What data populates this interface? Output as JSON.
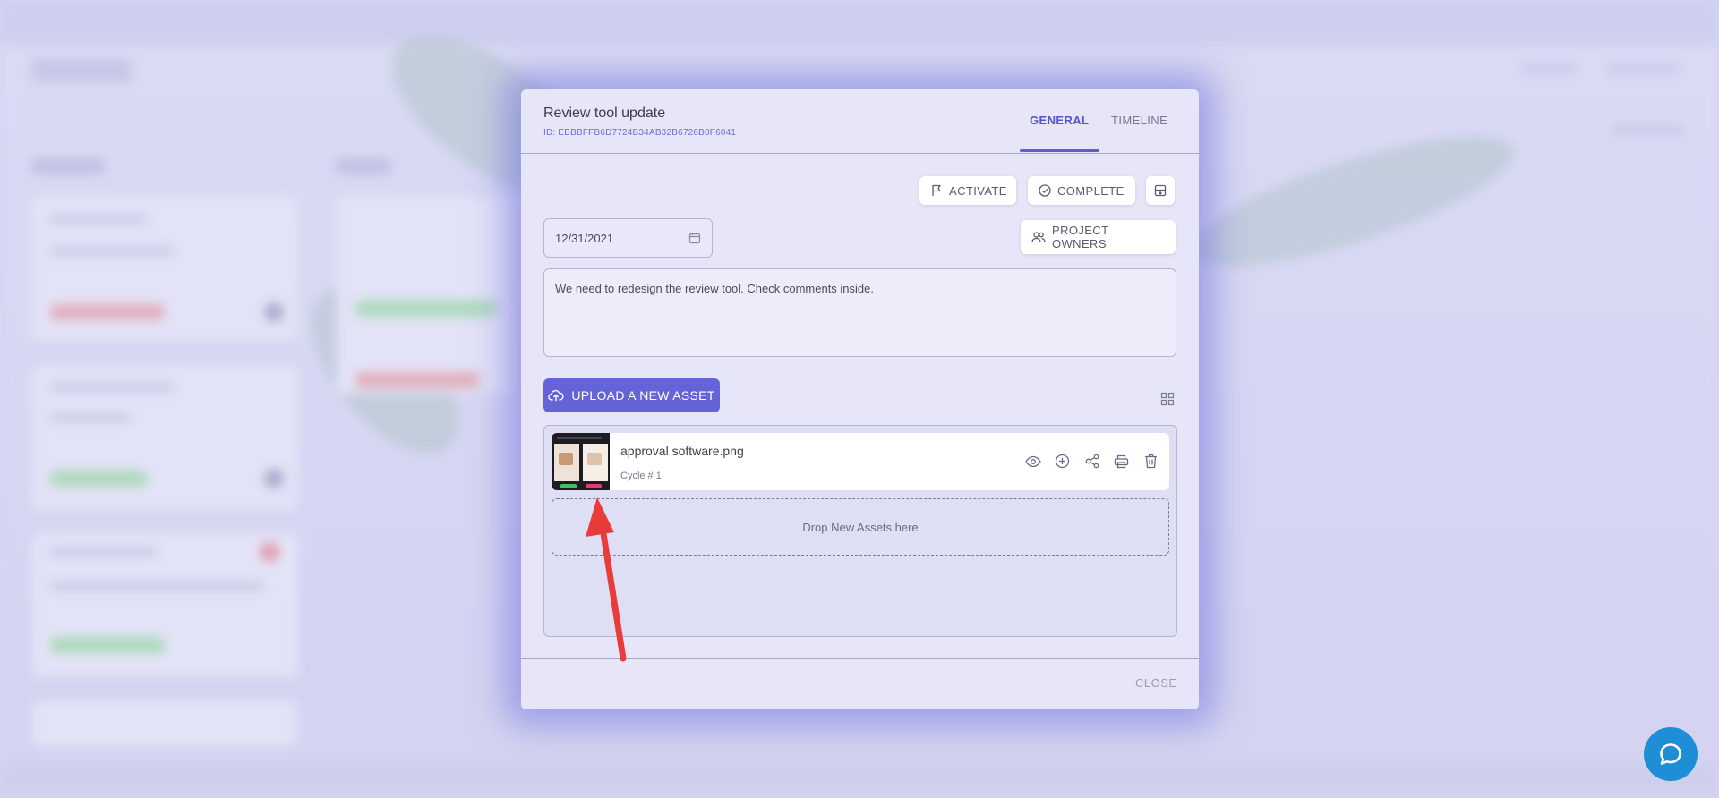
{
  "modal": {
    "title": "Review tool update",
    "id_label": "ID: EBBBFFB6D7724B34AB32B6726B0F6041",
    "tabs": [
      {
        "label": "GENERAL",
        "active": true
      },
      {
        "label": "TIMELINE",
        "active": false
      }
    ],
    "actions": {
      "activate_label": "ACTIVATE",
      "complete_label": "COMPLETE",
      "archive_icon": "archive-box-icon",
      "project_owners_label": "PROJECT OWNERS"
    },
    "due_date": "12/31/2021",
    "description": "We need to redesign the review tool. Check comments inside.",
    "upload_label": "UPLOAD A NEW ASSET",
    "assets": [
      {
        "name": "approval software.png",
        "cycle": "Cycle # 1",
        "actions": [
          "eye-icon",
          "plus-circle-icon",
          "share-icon",
          "print-icon",
          "trash-icon"
        ]
      }
    ],
    "dropzone_label": "Drop New Assets here",
    "close_label": "CLOSE"
  },
  "colors": {
    "accent": "#6464d8",
    "tab_active": "#5656c8",
    "chat": "#1e8fd6",
    "arrow": "#ea3b3b"
  }
}
